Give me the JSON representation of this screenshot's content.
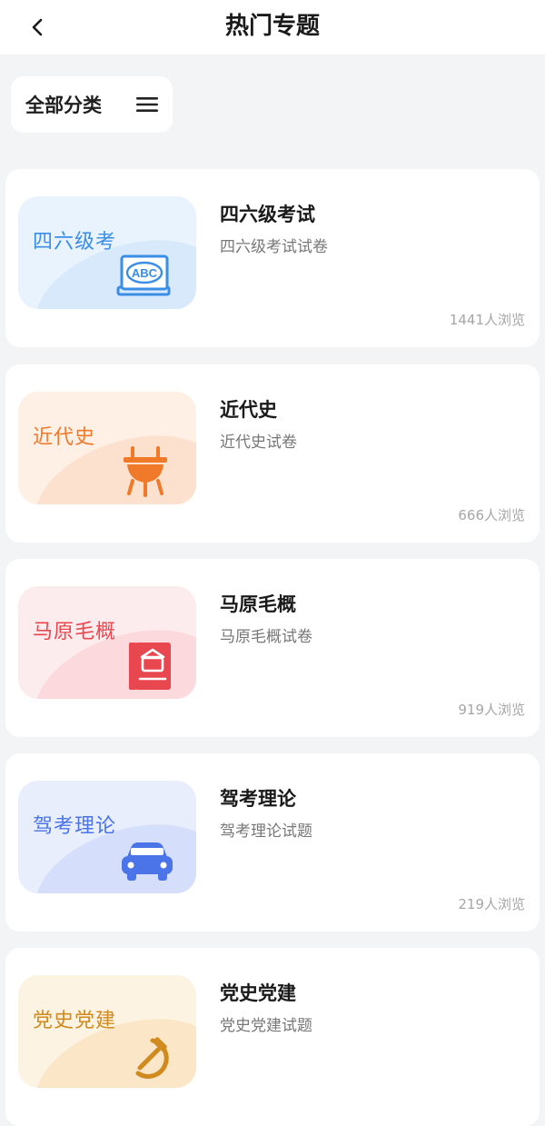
{
  "header": {
    "title": "热门专题"
  },
  "filter": {
    "label": "全部分类"
  },
  "cards": [
    {
      "thumb_label": "四六级考",
      "title": "四六级考试",
      "subtitle": "四六级考试试卷",
      "views": "1441人浏览",
      "icon": "abc-book-icon",
      "colors": {
        "bg": "#e8f3fd",
        "blob": "#d7e9fb",
        "accent": "#3a8ee6"
      }
    },
    {
      "thumb_label": "近代史",
      "title": "近代史",
      "subtitle": "近代史试卷",
      "views": "666人浏览",
      "icon": "bronze-cauldron-icon",
      "colors": {
        "bg": "#fff0e6",
        "blob": "#fde1cf",
        "accent": "#f07a2a"
      }
    },
    {
      "thumb_label": "马原毛概",
      "title": "马原毛概",
      "subtitle": "马原毛概试卷",
      "views": "919人浏览",
      "icon": "red-book-icon",
      "colors": {
        "bg": "#fdecee",
        "blob": "#fbd9dc",
        "accent": "#e9474f"
      }
    },
    {
      "thumb_label": "驾考理论",
      "title": "驾考理论",
      "subtitle": "驾考理论试题",
      "views": "219人浏览",
      "icon": "car-icon",
      "colors": {
        "bg": "#e9eefc",
        "blob": "#d5defa",
        "accent": "#4a74e8"
      }
    },
    {
      "thumb_label": "党史党建",
      "title": "党史党建",
      "subtitle": "党史党建试题",
      "views": "",
      "icon": "hammer-sickle-icon",
      "colors": {
        "bg": "#fdf3e2",
        "blob": "#fbe7c8",
        "accent": "#d08a1e"
      }
    }
  ]
}
